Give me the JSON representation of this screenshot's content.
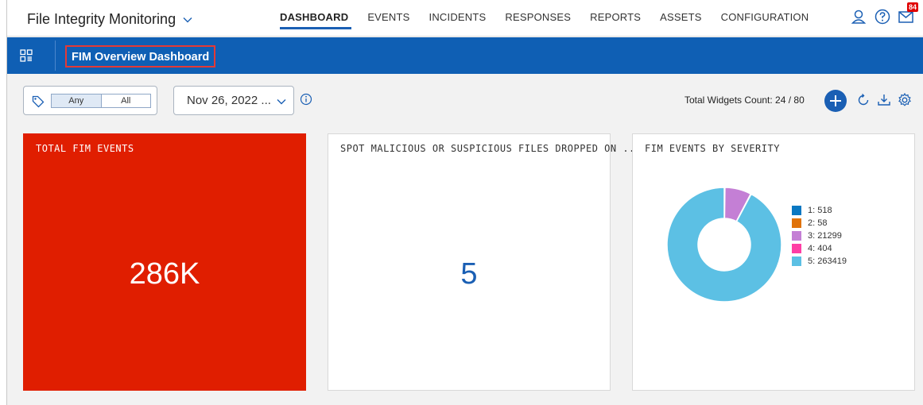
{
  "app": {
    "title": "File Integrity Monitoring"
  },
  "nav": {
    "tabs": [
      {
        "label": "DASHBOARD",
        "active": true
      },
      {
        "label": "EVENTS"
      },
      {
        "label": "INCIDENTS"
      },
      {
        "label": "RESPONSES"
      },
      {
        "label": "REPORTS"
      },
      {
        "label": "ASSETS"
      },
      {
        "label": "CONFIGURATION"
      }
    ],
    "mail_badge": "84"
  },
  "header": {
    "title": "FIM Overview Dashboard"
  },
  "toolbar": {
    "tag_any": "Any",
    "tag_all": "All",
    "date": "Nov 26, 2022 ...",
    "widgets_count": "Total Widgets Count: 24 / 80"
  },
  "widgets": {
    "total": {
      "title": "TOTAL FIM EVENTS",
      "value": "286K"
    },
    "malicious": {
      "title": "SPOT MALICIOUS OR SUSPICIOUS FILES DROPPED ON ...",
      "value": "5"
    },
    "severity": {
      "title": "FIM EVENTS BY SEVERITY",
      "legend": [
        {
          "label": "1: 518",
          "value": 518,
          "color": "#0a78c2"
        },
        {
          "label": "2: 58",
          "value": 58,
          "color": "#e0730a"
        },
        {
          "label": "3: 21299",
          "value": 21299,
          "color": "#c47fd5"
        },
        {
          "label": "4: 404",
          "value": 404,
          "color": "#ff3ea5"
        },
        {
          "label": "5: 263419",
          "value": 263419,
          "color": "#5cc0e4"
        }
      ]
    }
  },
  "colors": {
    "accent": "#0f5fb4",
    "total_tile": "#e01e00",
    "badge": "#e00000"
  }
}
